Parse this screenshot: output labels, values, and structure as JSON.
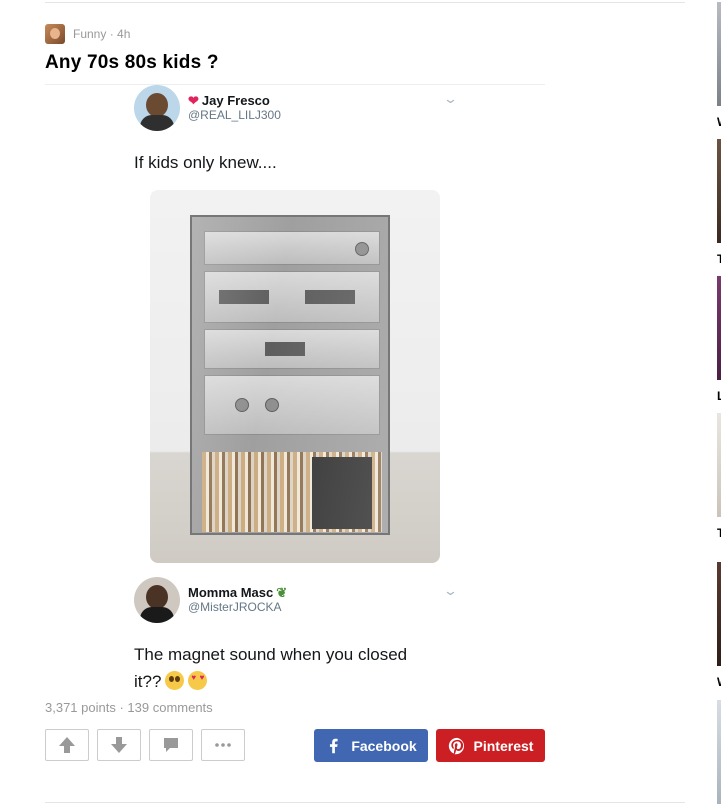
{
  "post": {
    "section": "Funny",
    "separator": " · ",
    "age": "4h",
    "title": "Any 70s 80s kids ?",
    "points": "3,371 points",
    "stats_separator": " · ",
    "comments": "139 comments"
  },
  "embedded_tweets": [
    {
      "name": "Jay Fresco",
      "handle": "@REAL_LILJ300",
      "text": "If kids only knew....",
      "name_icon": "heart-icon"
    },
    {
      "name": "Momma Masc",
      "handle": "@MisterJROCKA",
      "text_line1": "The magnet sound when you closed",
      "text_line2": "it??",
      "name_icon": "plant-icon"
    }
  ],
  "actions": {
    "upvote_icon": "up-arrow-icon",
    "downvote_icon": "down-arrow-icon",
    "comment_icon": "comment-bubble-icon",
    "more_icon": "more-dots-icon",
    "facebook_label": "Facebook",
    "pinterest_label": "Pinterest"
  },
  "sidebar": {
    "captions": [
      "W",
      "T",
      "L",
      "T",
      "W"
    ]
  },
  "colors": {
    "facebook": "#4267b2",
    "pinterest": "#cb1f24",
    "muted_text": "#999999",
    "rule": "#e5e5e5"
  }
}
